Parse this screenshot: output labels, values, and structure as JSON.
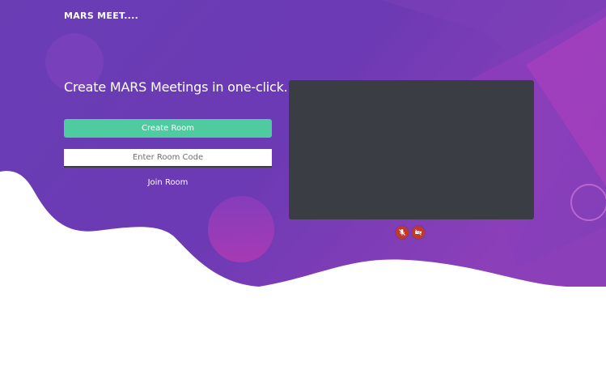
{
  "header": {
    "logo_text": "MARS MEET...."
  },
  "hero": {
    "headline": "Create MARS Meetings in one-click."
  },
  "actions": {
    "create_label": "Create Room",
    "room_code_placeholder": "Enter Room Code",
    "room_code_value": "",
    "join_label": "Join Room"
  },
  "controls": {
    "mic_icon": "mic-muted-icon",
    "camera_icon": "camera-off-icon"
  },
  "colors": {
    "hero_gradient_start": "#6a3db5",
    "hero_gradient_end": "#8b3fb8",
    "accent_green": "#4ecb9f",
    "video_bg": "#3a3d44",
    "control_red": "#c0392b"
  }
}
